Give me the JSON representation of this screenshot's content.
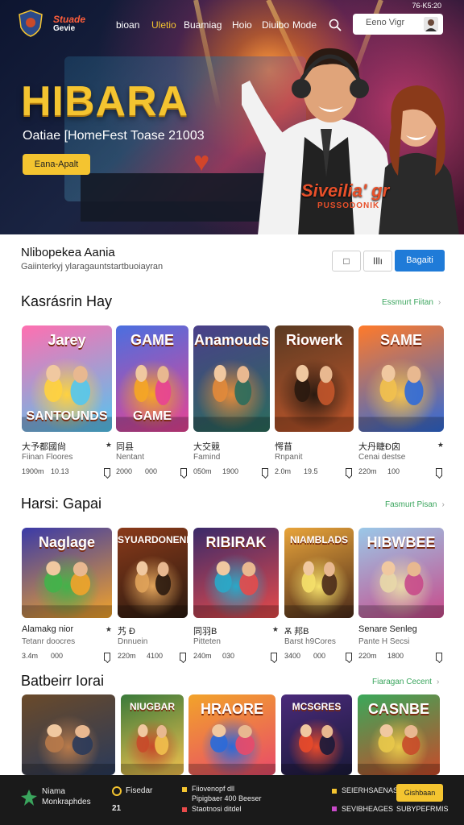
{
  "nav": {
    "brand_line1": "Stuade",
    "brand_line2": "Gevie",
    "links": [
      "bioan",
      "Uletio",
      "Buamiag",
      "Hoio",
      "Diuibo",
      "Mode"
    ],
    "search_placeholder": "Eeno Vigr",
    "status": "76-K5:20"
  },
  "hero": {
    "title": "HIBARA",
    "subtitle": "Oatiae [HomeFest Toase  21003",
    "button": "Eana-Apalt",
    "sign_main": "Siveilia' gr",
    "sign_sub": "PUSSODONIK"
  },
  "filter": {
    "title": "Nlibopekea Aania",
    "desc": "Gaiinterkyj ylaragauntstartbuoiayran",
    "btn_grid": "□",
    "btn_list": "Illı",
    "btn_primary": "Bagaiti"
  },
  "sections": [
    {
      "title": "Kasrásrin Hay",
      "link": "Essmurt Fiitan",
      "cards": [
        {
          "thumb": "Jarey",
          "thumb2": "SANTOUNDS",
          "t1": "大予都國尙",
          "icon": "★",
          "t2": "Fiinan Floores",
          "m1": "1900m",
          "m2": "10.13",
          "colors": [
            "#ff6fb0",
            "#ffd23f",
            "#53c6f0"
          ]
        },
        {
          "thumb": "GAME",
          "thumb2": "GAME",
          "t1": "同县",
          "icon": "",
          "t2": "Nentant",
          "m1": "2000",
          "m2": "000",
          "colors": [
            "#4a6fe0",
            "#f5a623",
            "#e84393"
          ]
        },
        {
          "thumb": "Anamouds",
          "thumb2": "",
          "t1": "大交競",
          "icon": "",
          "t2": "Famind",
          "m1": "050m",
          "m2": "1900",
          "colors": [
            "#4a3f8a",
            "#e28a3a",
            "#2b6d5c"
          ]
        },
        {
          "thumb": "Riowerk",
          "thumb2": "",
          "t1": "愕苜",
          "icon": "",
          "t2": "Rnpanit",
          "m1": "2.0m",
          "m2": "19.5",
          "colors": [
            "#5a3a22",
            "#2a1a10",
            "#c4572b"
          ]
        },
        {
          "thumb": "SAME",
          "thumb2": "",
          "t1": "大丹睫Ð囟",
          "icon": "★",
          "t2": "Cenai destse",
          "m1": "220m",
          "m2": "100",
          "colors": [
            "#ff7a2a",
            "#f2c14e",
            "#2f6ad9"
          ]
        }
      ]
    },
    {
      "title": "Harsi: Gapai",
      "link": "Fasmurt Pisan",
      "cards": [
        {
          "thumb": "Naglage",
          "thumb2": "",
          "t1": "Alamakg nior",
          "icon": "★",
          "t2": "Tetanr doocres",
          "m1": "3.4m",
          "m2": "000",
          "colors": [
            "#3a3aa8",
            "#43b24a",
            "#f2a32a"
          ]
        },
        {
          "thumb": "SYUARDONENE",
          "thumb2": "",
          "t1": "艿 Ð",
          "icon": "",
          "t2": "Dnnuein",
          "m1": "220m",
          "m2": "4100",
          "colors": [
            "#8a3a1a",
            "#e0a35a",
            "#2a1a10"
          ]
        },
        {
          "thumb": "RIBIRAK",
          "thumb2": "",
          "t1": "同羽B",
          "icon": "★",
          "t2": "Pitteten",
          "m1": "240m",
          "m2": "030",
          "colors": [
            "#3a2a6a",
            "#2aa8c8",
            "#e64a4a"
          ]
        },
        {
          "thumb": "NIAMBLADS",
          "thumb2": "",
          "t1": "Ѫ 邦B",
          "icon": "",
          "t2": "Barst h9Cores",
          "m1": "3400",
          "m2": "000",
          "colors": [
            "#e8a43a",
            "#f5e06a",
            "#4a2a1a"
          ]
        },
        {
          "thumb": "HIBWBEE",
          "thumb2": "",
          "t1": "Senare Senleg",
          "icon": "",
          "t2": "Pante H Secsi",
          "m1": "220m",
          "m2": "1800",
          "colors": [
            "#9ac8e8",
            "#e8d8a8",
            "#c84a8a"
          ]
        }
      ]
    },
    {
      "title": "Batbeirr Iorai",
      "link": "Fiaragan Cecent",
      "cards": [
        {
          "thumb": "",
          "thumb2": "",
          "colors": [
            "#6a4a2a",
            "#b87a4a",
            "#2a3a5a"
          ]
        },
        {
          "thumb": "NIUGBAR",
          "thumb2": "",
          "colors": [
            "#3a7a3a",
            "#c84a2a",
            "#f2c14e"
          ]
        },
        {
          "thumb": "HRAORE",
          "thumb2": "",
          "colors": [
            "#f2a32a",
            "#2a6ad9",
            "#e84a6a"
          ]
        },
        {
          "thumb": "MCSGRES",
          "thumb2": "",
          "colors": [
            "#4a2a7a",
            "#e84a2a",
            "#1a1a3a"
          ]
        },
        {
          "thumb": "CASNBE",
          "thumb2": "",
          "colors": [
            "#3aa85a",
            "#e8c84a",
            "#c84a2a"
          ]
        }
      ]
    }
  ],
  "footer": {
    "brand_line1": "Niama",
    "brand_line2": "Monkraphdes",
    "coin_label": "Fisedar",
    "coin_value": "21",
    "mid_line1": "Fiiovenopf dll",
    "mid_line2": "Pipigbaer 400 Beeser",
    "mid_line3": "Staotnosi ditdel",
    "right_line1": "SEIERHSAENAS",
    "right_line2": "SEVIBHEAGES",
    "right_line3": "SUBYPEFRMIS",
    "button": "Gishbaan"
  },
  "colors": {
    "accent_yellow": "#f4c430",
    "primary_blue": "#1f7bd8",
    "link_green": "#3aa55d",
    "footer_bg": "#1a1a1a"
  }
}
